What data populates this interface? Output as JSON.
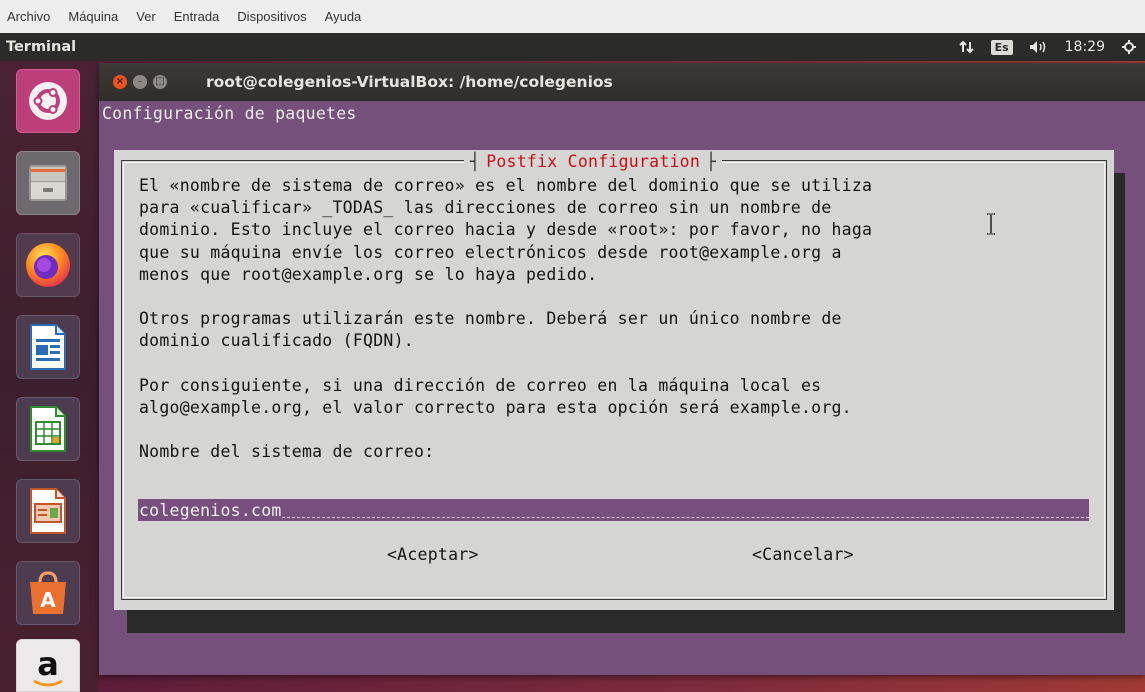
{
  "vbox_menu": [
    "Archivo",
    "Máquina",
    "Ver",
    "Entrada",
    "Dispositivos",
    "Ayuda"
  ],
  "panel": {
    "app_title": "Terminal",
    "keyboard_layout": "Es",
    "clock": "18:29"
  },
  "launcher": [
    {
      "name": "ubuntu-dash-icon"
    },
    {
      "name": "files-icon"
    },
    {
      "name": "firefox-icon"
    },
    {
      "name": "libreoffice-writer-icon"
    },
    {
      "name": "libreoffice-calc-icon"
    },
    {
      "name": "libreoffice-impress-icon"
    },
    {
      "name": "ubuntu-software-icon"
    },
    {
      "name": "amazon-icon"
    }
  ],
  "terminal": {
    "title": "root@colegenios-VirtualBox: /home/colegenios",
    "backtitle": "Configuración de paquetes",
    "dialog": {
      "title": "Postfix Configuration",
      "lines": [
        "El «nombre de sistema de correo» es el nombre del dominio que se utiliza",
        "para «cualificar» _TODAS_ las direcciones de correo sin un nombre de",
        "dominio. Esto incluye el correo hacia y desde «root»: por favor, no haga",
        "que su máquina envíe los correo electrónicos desde root@example.org a",
        "menos que root@example.org se lo haya pedido.",
        "",
        "Otros programas utilizarán este nombre. Deberá ser un único nombre de",
        "dominio cualificado (FQDN).",
        "",
        "Por consiguiente, si una dirección de correo en la máquina local es",
        "algo@example.org, el valor correcto para esta opción será example.org.",
        "",
        "Nombre del sistema de correo:"
      ],
      "input_value": "colegenios.com",
      "accept_label": "<Aceptar>",
      "cancel_label": "<Cancelar>"
    }
  },
  "colors": {
    "terminal_bg": "#75507b",
    "dialog_bg": "#d5d5d3",
    "dialog_title": "#c4121a",
    "ubuntu_orange": "#e95420"
  }
}
